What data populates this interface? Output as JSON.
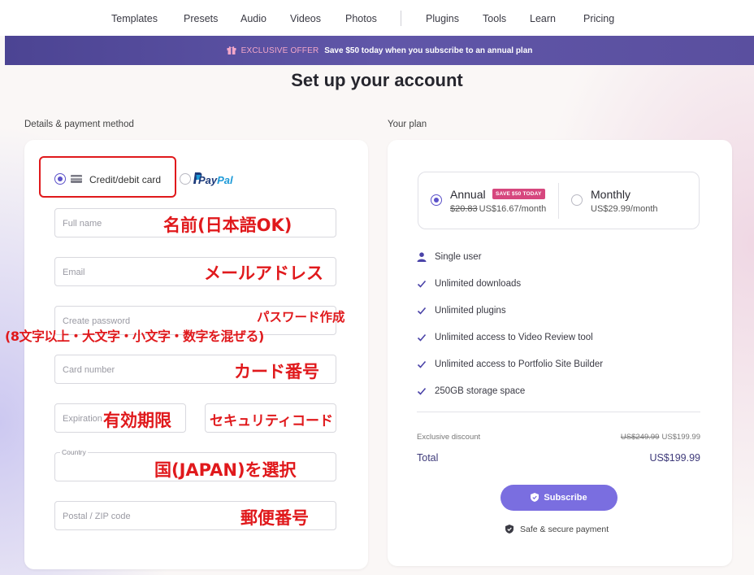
{
  "nav": {
    "items": [
      "Templates",
      "Presets",
      "Audio",
      "Videos",
      "Photos",
      "Plugins",
      "Tools",
      "Learn",
      "Pricing"
    ]
  },
  "banner": {
    "tag": "EXCLUSIVE OFFER",
    "message": "Save $50 today when you subscribe to an annual plan"
  },
  "page": {
    "title": "Set up your account"
  },
  "details": {
    "section_label": "Details & payment method",
    "payment_methods": {
      "card_label": "Credit/debit card",
      "paypal_part1": "Pay",
      "paypal_part2": "Pal",
      "selected": "card"
    },
    "fields": {
      "full_name": "Full name",
      "email": "Email",
      "password": "Create password",
      "card_number": "Card number",
      "expiration": "Expiration",
      "country_legend": "Country",
      "postal": "Postal / ZIP code"
    }
  },
  "annotations": {
    "full_name": "名前(日本語OK)",
    "email": "メールアドレス",
    "password_line1": "パスワード作成",
    "password_line2": "(8文字以上・大文字・小文字・数字を混ぜる)",
    "card_number": "カード番号",
    "expiration": "有効期限",
    "security_code": "セキュリティコード",
    "country": "国(JAPAN)を選択",
    "postal": "郵便番号"
  },
  "plan": {
    "section_label": "Your plan",
    "annual": {
      "name": "Annual",
      "badge": "SAVE $50 TODAY",
      "old_price": "$20.83",
      "price": "US$16.67/month",
      "selected": true
    },
    "monthly": {
      "name": "Monthly",
      "price": "US$29.99/month",
      "selected": false
    },
    "features": [
      {
        "icon": "user-icon",
        "text": "Single user"
      },
      {
        "icon": "check-icon",
        "text": "Unlimited downloads"
      },
      {
        "icon": "check-icon",
        "text": "Unlimited plugins"
      },
      {
        "icon": "check-icon",
        "text": "Unlimited access to Video Review tool"
      },
      {
        "icon": "check-icon",
        "text": "Unlimited access to Portfolio Site Builder"
      },
      {
        "icon": "check-icon",
        "text": "250GB storage space"
      }
    ],
    "discount_label": "Exclusive discount",
    "discount_old": "US$249.99",
    "discount_new": "US$199.99",
    "total_label": "Total",
    "total_value": "US$199.99",
    "subscribe_label": "Subscribe",
    "secure_label": "Safe & secure payment"
  },
  "colors": {
    "accent": "#5b51c9",
    "button": "#7a6ee0",
    "banner": "#554b9f",
    "annotation": "#e0191c",
    "badge": "#d6477e"
  }
}
